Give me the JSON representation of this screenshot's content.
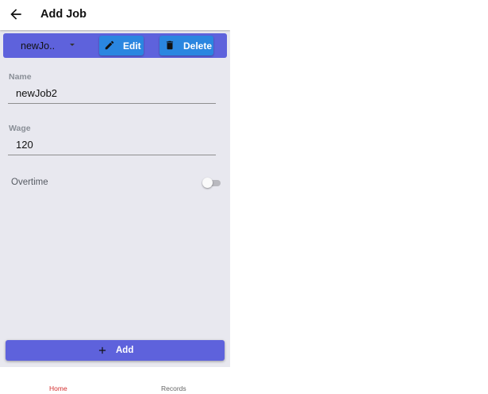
{
  "appbar": {
    "title": "Add Job",
    "back_icon": "arrow-left-icon"
  },
  "toolbar": {
    "job_select_value": "newJo..",
    "edit_label": "Edit",
    "edit_icon": "pencil-icon",
    "delete_label": "Delete",
    "delete_icon": "trash-icon"
  },
  "form": {
    "name_label": "Name",
    "name_value": "newJob2",
    "wage_label": "Wage",
    "wage_value": "120",
    "overtime_label": "Overtime",
    "overtime_enabled": false
  },
  "add_button": {
    "label": "Add",
    "icon": "plus-icon"
  },
  "bottom_nav": {
    "items": [
      {
        "label": "Home",
        "active": true
      },
      {
        "label": "Records",
        "active": false
      }
    ]
  },
  "colors": {
    "primary": "#5e62dc",
    "button_blue": "#2a86e0",
    "background": "#e8e8ef",
    "active_nav": "#d32f2f",
    "inactive_nav": "#666666"
  }
}
